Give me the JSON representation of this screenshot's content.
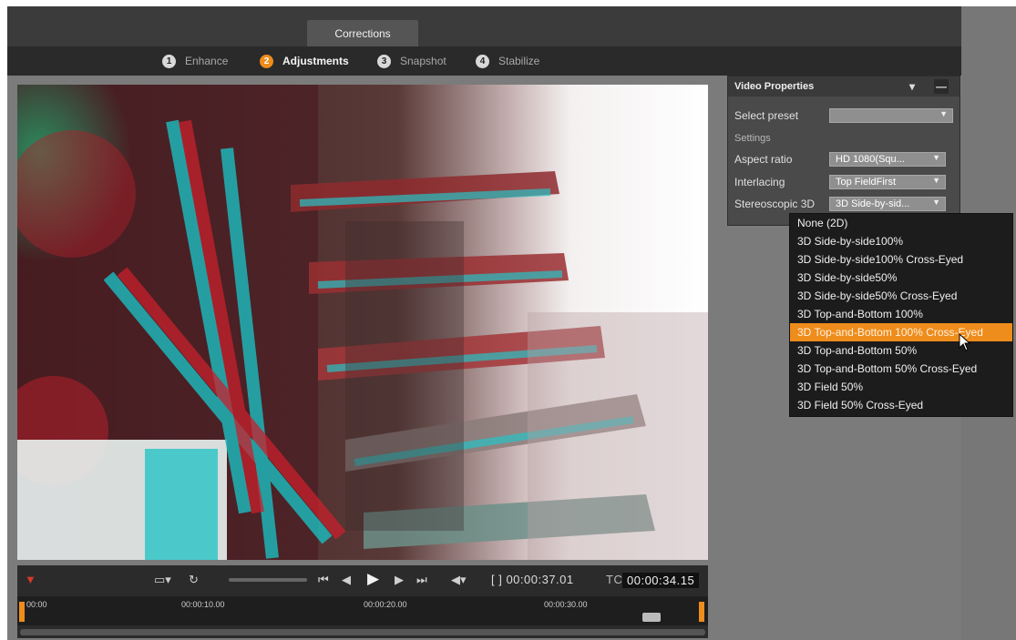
{
  "header": {
    "active_tab": "Corrections"
  },
  "steps": [
    {
      "num": "1",
      "label": "Enhance"
    },
    {
      "num": "2",
      "label": "Adjustments"
    },
    {
      "num": "3",
      "label": "Snapshot"
    },
    {
      "num": "4",
      "label": "Stabilize"
    }
  ],
  "video_properties": {
    "title": "Video Properties",
    "minimize_icon": "▾",
    "close_icon": "—",
    "select_preset_label": "Select preset",
    "select_preset_value": "",
    "settings_label": "Settings",
    "aspect_ratio_label": "Aspect ratio",
    "aspect_ratio_value": "HD 1080(Squ...",
    "interlacing_label": "Interlacing",
    "interlacing_value": "Top FieldFirst",
    "stereoscopic_label": "Stereoscopic 3D",
    "stereoscopic_value": "3D Side-by-sid..."
  },
  "stereo_dropdown": {
    "options": [
      "None (2D)",
      "3D Side-by-side100%",
      "3D Side-by-side100% Cross-Eyed",
      "3D Side-by-side50%",
      "3D Side-by-side50% Cross-Eyed",
      "3D Top-and-Bottom 100%",
      "3D Top-and-Bottom 100% Cross-Eyed",
      "3D Top-and-Bottom 50%",
      "3D Top-and-Bottom 50% Cross-Eyed",
      "3D Field 50%",
      "3D Field 50% Cross-Eyed"
    ],
    "highlighted": 6
  },
  "transport": {
    "duration": "[ ] 00:00:37.01",
    "tc_label": "TC",
    "tc_value": "00:00:34.15",
    "ruler": [
      "00:00",
      "00:00:10.00",
      "00:00:20.00",
      "00:00:30.00"
    ]
  },
  "colors": {
    "accent": "#ee8c1c"
  }
}
